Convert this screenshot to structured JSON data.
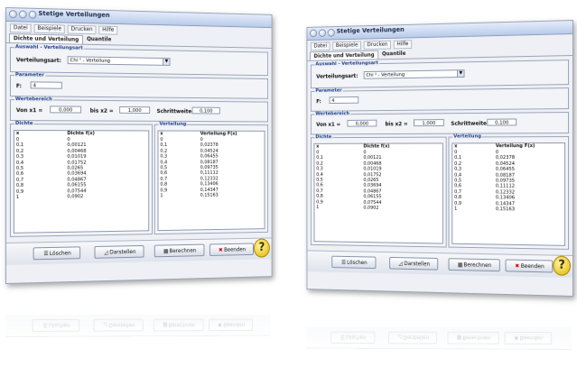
{
  "window": {
    "title": "Stetige Verteilungen",
    "menu": [
      "Datei",
      "Beispiele",
      "Drucken",
      "Hilfe"
    ],
    "tabs": [
      "Dichte und Verteilung",
      "Quantile"
    ]
  },
  "auswahl": {
    "group_label": "Auswahl - Verteilungsart",
    "label": "Verteilungsart:",
    "selected": "Chi ² - Verteilung"
  },
  "parameter": {
    "group_label": "Parameter",
    "f_label": "F:",
    "f_value": "4"
  },
  "wertebereich": {
    "group_label": "Wertebereich",
    "von_label": "Von x1 =",
    "von_value": "0,000",
    "bis_label": "bis x2 =",
    "bis_value": "1,000",
    "schritt_label": "Schrittweite:",
    "schritt_value": "0,100"
  },
  "dichte": {
    "group_label": "Dichte",
    "col_x": "x",
    "col_val": "Dichte f(x)",
    "rows": [
      [
        "0",
        "0"
      ],
      [
        "0,1",
        "0,00121"
      ],
      [
        "0,2",
        "0,00468"
      ],
      [
        "0,3",
        "0,01019"
      ],
      [
        "0,4",
        "0,01752"
      ],
      [
        "0,5",
        "0,0265"
      ],
      [
        "0,6",
        "0,03694"
      ],
      [
        "0,7",
        "0,04867"
      ],
      [
        "0,8",
        "0,06155"
      ],
      [
        "0,9",
        "0,07544"
      ],
      [
        "1",
        "0,0902"
      ]
    ]
  },
  "verteilung": {
    "group_label": "Verteilung",
    "col_x": "x",
    "col_val": "Verteilung F(x)",
    "rows": [
      [
        "0",
        "0"
      ],
      [
        "0,1",
        "0,02378"
      ],
      [
        "0,2",
        "0,04524"
      ],
      [
        "0,3",
        "0,06455"
      ],
      [
        "0,4",
        "0,08187"
      ],
      [
        "0,5",
        "0,09735"
      ],
      [
        "0,6",
        "0,11112"
      ],
      [
        "0,7",
        "0,12332"
      ],
      [
        "0,8",
        "0,13406"
      ],
      [
        "0,9",
        "0,14347"
      ],
      [
        "1",
        "0,15163"
      ]
    ]
  },
  "buttons": {
    "clear": "Löschen",
    "plot": "Darstellen",
    "calc": "Berechnen",
    "quit": "Beenden"
  }
}
